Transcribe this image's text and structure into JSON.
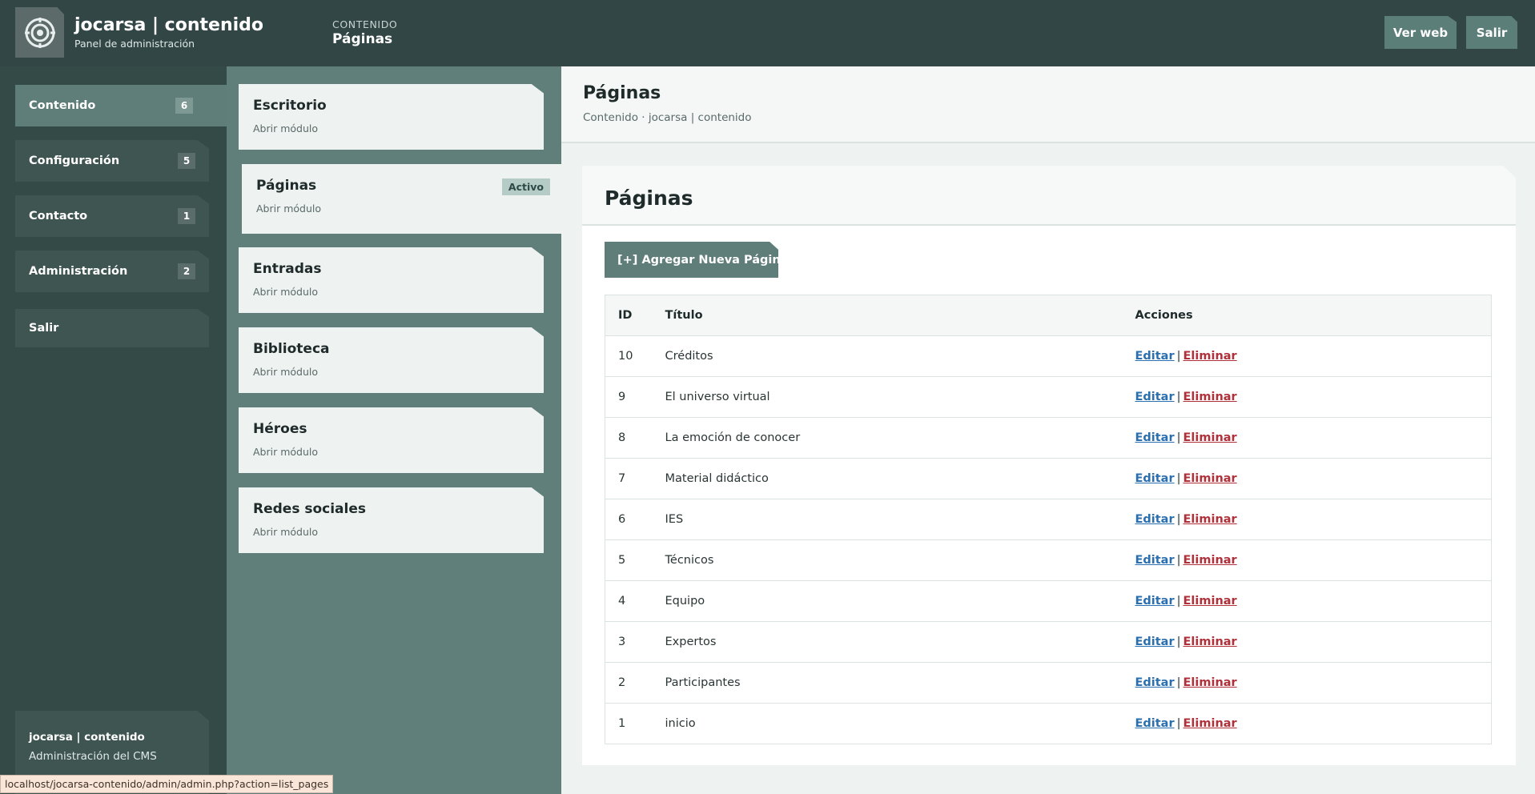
{
  "header": {
    "brand_title": "jocarsa | contenido",
    "brand_subtitle": "Panel de administración",
    "crumb_category": "CONTENIDO",
    "crumb_page": "Páginas",
    "buttons": {
      "view_site": "Ver web",
      "logout": "Salir"
    }
  },
  "sidebar": {
    "items": [
      {
        "label": "Contenido",
        "count": "6"
      },
      {
        "label": "Configuración",
        "count": "5"
      },
      {
        "label": "Contacto",
        "count": "1"
      },
      {
        "label": "Administración",
        "count": "2"
      },
      {
        "label": "Salir"
      }
    ],
    "footer": {
      "title": "jocarsa | contenido",
      "subtitle": "Administración del CMS"
    }
  },
  "modules": {
    "items": [
      {
        "title": "Escritorio",
        "subtitle": "Abrir módulo"
      },
      {
        "title": "Páginas",
        "subtitle": "Abrir módulo",
        "badge": "Activo"
      },
      {
        "title": "Entradas",
        "subtitle": "Abrir módulo"
      },
      {
        "title": "Biblioteca",
        "subtitle": "Abrir módulo"
      },
      {
        "title": "Héroes",
        "subtitle": "Abrir módulo"
      },
      {
        "title": "Redes sociales",
        "subtitle": "Abrir módulo"
      }
    ]
  },
  "main": {
    "title": "Páginas",
    "subtitle": "Contenido · jocarsa | contenido",
    "panel_title": "Páginas",
    "add_button": "[+] Agregar Nueva Página",
    "table": {
      "headers": [
        "ID",
        "Título",
        "Acciones"
      ],
      "edit_label": "Editar",
      "delete_label": "Eliminar",
      "separator": "|",
      "rows": [
        {
          "id": "10",
          "title": "Créditos"
        },
        {
          "id": "9",
          "title": "El universo virtual"
        },
        {
          "id": "8",
          "title": "La emoción de conocer"
        },
        {
          "id": "7",
          "title": "Material didáctico"
        },
        {
          "id": "6",
          "title": "IES"
        },
        {
          "id": "5",
          "title": "Técnicos"
        },
        {
          "id": "4",
          "title": "Equipo"
        },
        {
          "id": "3",
          "title": "Expertos"
        },
        {
          "id": "2",
          "title": "Participantes"
        },
        {
          "id": "1",
          "title": "inicio"
        }
      ]
    }
  },
  "status_bar": "localhost/jocarsa-contenido/admin/admin.php?action=list_pages",
  "colors": {
    "topbar": "#314645",
    "sidebar": "#334a47",
    "accent": "#5f7d79",
    "edit_link": "#2a6fb0",
    "delete_link": "#b0303a"
  }
}
